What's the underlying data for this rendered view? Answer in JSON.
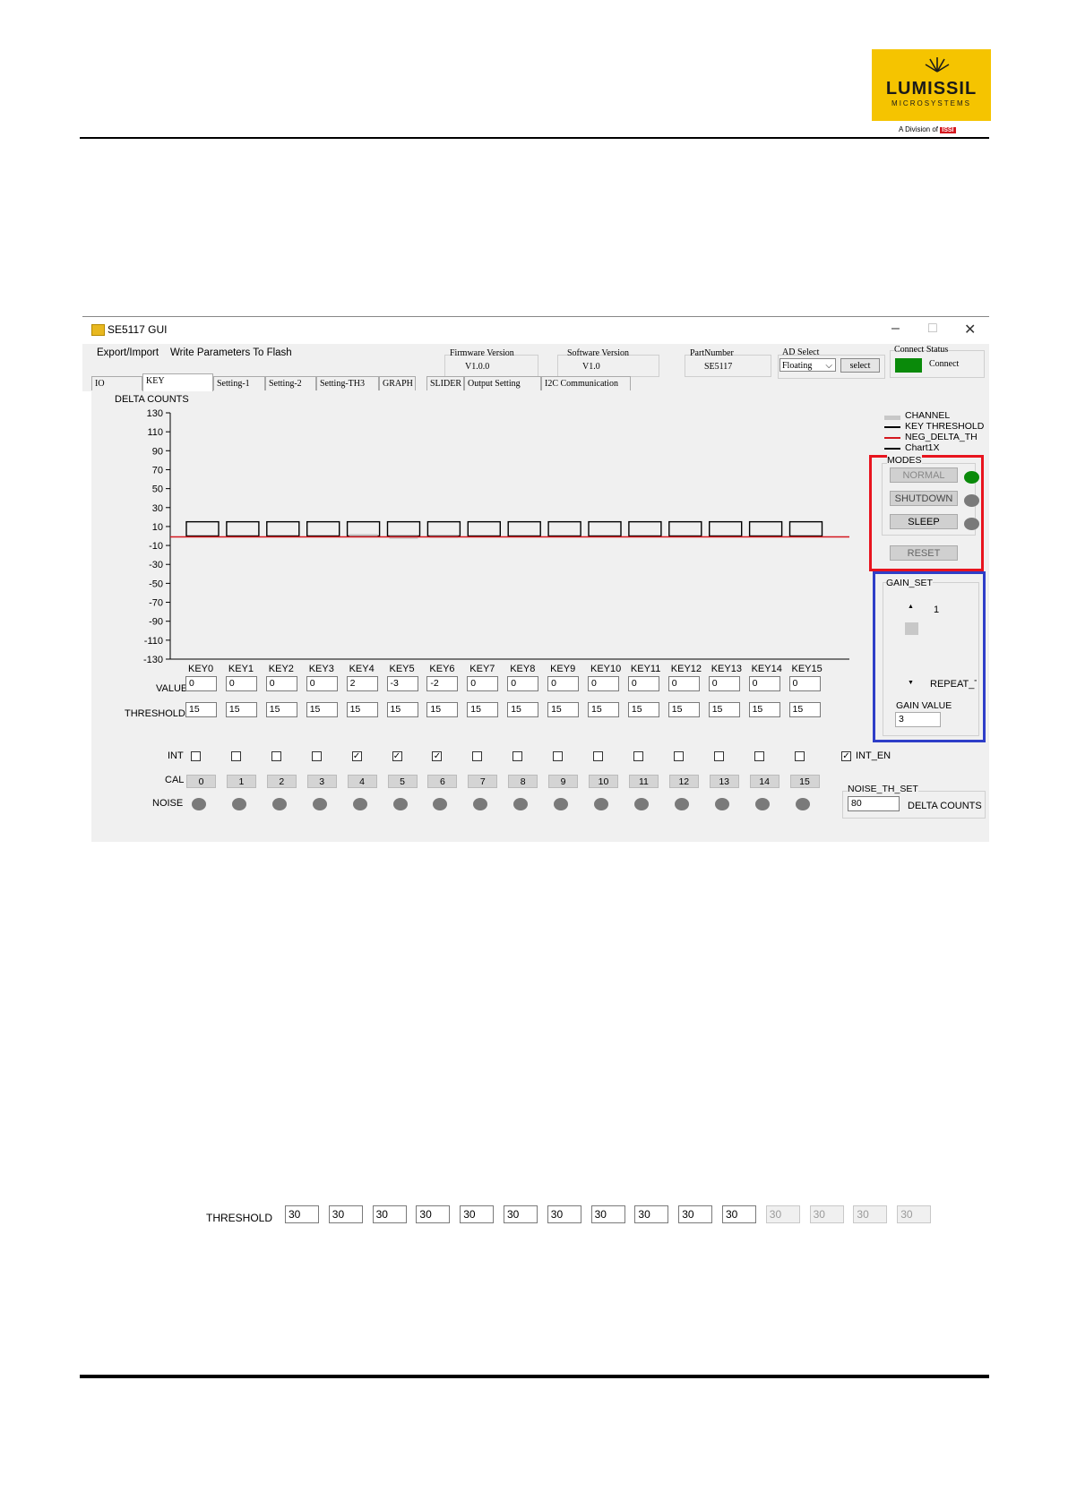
{
  "header": {
    "logo_text": "LUMISSIL",
    "logo_sub": "MICROSYSTEMS",
    "division": "A Division of",
    "division_brand": "ISSI"
  },
  "window": {
    "title": "SE5117 GUI",
    "min": "–",
    "max": "□",
    "close": "✕"
  },
  "menu": {
    "export": "Export/Import",
    "write": "Write Parameters To Flash",
    "fw_label": "Firmware Version",
    "fw_value": "V1.0.0",
    "sw_label": "Software Version",
    "sw_value": "V1.0",
    "pn_label": "PartNumber",
    "pn_value": "SE5117",
    "ad_label": "AD Select",
    "ad_value": "Floating",
    "select_btn": "select",
    "conn_label": "Connect Status",
    "conn_value": "Connect"
  },
  "tabs": [
    "IO CONFIG",
    "KEY VARIATION",
    "Setting-1",
    "Setting-2",
    "Setting-TH3",
    "GRAPH",
    "SLIDER",
    "Output Setting",
    "I2C Communication"
  ],
  "chart_data": {
    "type": "bar",
    "ylabel": "DELTA COUNTS",
    "ylim": [
      -130,
      130
    ],
    "yticks": [
      130,
      110,
      90,
      70,
      50,
      30,
      10,
      -10,
      -30,
      -50,
      -70,
      -90,
      -110,
      -130
    ],
    "categories": [
      "KEY0",
      "KEY1",
      "KEY2",
      "KEY3",
      "KEY4",
      "KEY5",
      "KEY6",
      "KEY7",
      "KEY8",
      "KEY9",
      "KEY10",
      "KEY11",
      "KEY12",
      "KEY13",
      "KEY14",
      "KEY15"
    ],
    "series": [
      {
        "name": "CHANNEL",
        "values": [
          0,
          0,
          0,
          0,
          2,
          -3,
          -2,
          0,
          0,
          0,
          0,
          0,
          0,
          0,
          0,
          0
        ]
      },
      {
        "name": "KEY THRESHOLD",
        "values": [
          15,
          15,
          15,
          15,
          15,
          15,
          15,
          15,
          15,
          15,
          15,
          15,
          15,
          15,
          15,
          15
        ]
      },
      {
        "name": "NEG_DELTA_TH",
        "values": [
          0,
          0,
          0,
          0,
          0,
          0,
          0,
          0,
          0,
          0,
          0,
          0,
          0,
          0,
          0,
          0
        ]
      }
    ],
    "legend": [
      "CHANNEL",
      "KEY THRESHOLD",
      "NEG_DELTA_TH",
      "Chart1X"
    ],
    "legend_colors": [
      "#c8c8c8",
      "#000000",
      "#d4181f",
      "#000000"
    ]
  },
  "rows": {
    "value_label": "VALUE",
    "threshold_label": "THRESHOLD",
    "int_label": "INT",
    "cal_label": "CAL",
    "noise_label": "NOISE",
    "values": [
      "0",
      "0",
      "0",
      "0",
      "2",
      "-3",
      "-2",
      "0",
      "0",
      "0",
      "0",
      "0",
      "0",
      "0",
      "0",
      "0"
    ],
    "thresholds": [
      "15",
      "15",
      "15",
      "15",
      "15",
      "15",
      "15",
      "15",
      "15",
      "15",
      "15",
      "15",
      "15",
      "15",
      "15",
      "15"
    ],
    "int_checked": [
      false,
      false,
      false,
      false,
      true,
      true,
      true,
      false,
      false,
      false,
      false,
      false,
      false,
      false,
      false,
      false
    ],
    "cal": [
      "0",
      "1",
      "2",
      "3",
      "4",
      "5",
      "6",
      "7",
      "8",
      "9",
      "10",
      "11",
      "12",
      "13",
      "14",
      "15"
    ],
    "int_en_label": "INT_EN",
    "check_mark": "✓"
  },
  "modes": {
    "title": "MODES",
    "normal": "NORMAL",
    "shutdown": "SHUTDOWN",
    "sleep": "SLEEP",
    "reset": "RESET",
    "normal_color": "#0a8a0a",
    "off_color": "#7a7a7a"
  },
  "gain": {
    "title": "GAIN_SET",
    "value_1": "1",
    "repeat": "REPEAT_TIM",
    "gain_value_label": "GAIN VALUE",
    "gain_value": "3",
    "up": "▲",
    "down": "▼"
  },
  "noise_th": {
    "title": "NOISE_TH_SET",
    "value": "80",
    "unit": "DELTA COUNTS"
  },
  "threshold_strip": {
    "label": "THRESHOLD",
    "values": [
      "30",
      "30",
      "30",
      "30",
      "30",
      "30",
      "30",
      "30",
      "30",
      "30",
      "30",
      "30",
      "30",
      "30",
      "30"
    ],
    "enabled": [
      true,
      true,
      true,
      true,
      true,
      true,
      true,
      true,
      true,
      true,
      true,
      false,
      false,
      false,
      false
    ]
  }
}
